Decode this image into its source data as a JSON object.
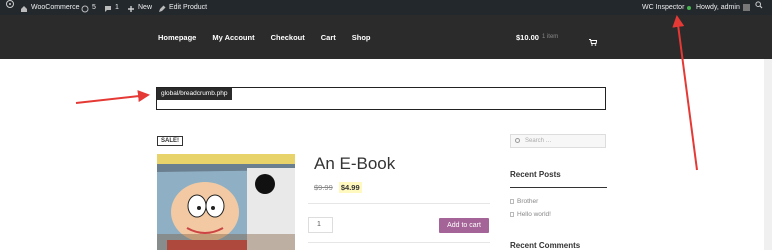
{
  "admin_bar": {
    "site_name": "WooCommerce",
    "updates_count": "5",
    "comments_count": "1",
    "new_label": "New",
    "edit_label": "Edit Product",
    "wc_inspector": "WC Inspector",
    "howdy": "Howdy, admin"
  },
  "nav": {
    "items": [
      "Homepage",
      "My Account",
      "Checkout",
      "Cart",
      "Shop"
    ]
  },
  "cart": {
    "amount": "$10.00",
    "items": "1 item"
  },
  "breadcrumb_label": "global/breadcrumb.php",
  "product": {
    "sale_badge": "SALE!",
    "title": "An E-Book",
    "old_price": "$9.99",
    "new_price": "$4.99",
    "quantity": "1",
    "add_to_cart": "Add to cart"
  },
  "sidebar": {
    "search_placeholder": "Search …",
    "recent_posts_title": "Recent Posts",
    "posts": [
      "Brother",
      "Hello world!"
    ],
    "recent_comments_title": "Recent Comments"
  },
  "colors": {
    "arrow": "#e53935",
    "woo_purple": "#a46497",
    "admin_bar": "#23282d"
  }
}
